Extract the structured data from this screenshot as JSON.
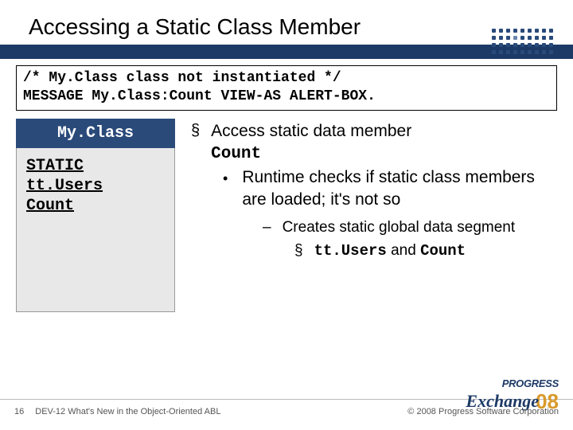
{
  "title": "Accessing a Static Class Member",
  "code": {
    "line1": "/* My.Class class not instantiated */",
    "line2": "MESSAGE My.Class:Count VIEW-AS ALERT-BOX."
  },
  "classBox": {
    "header": "My.Class",
    "line1": "STATIC",
    "line2": "tt.Users",
    "line3": "Count"
  },
  "bullets": {
    "main": "Access static data member",
    "mainCode": "Count",
    "sub": "Runtime checks if static class members are loaded; it's not so",
    "subsub": "Creates static global data segment",
    "subsubItemPrefix": "tt.Users",
    "subsubItemMid": " and ",
    "subsubItemSuffix": "Count"
  },
  "footer": {
    "slideNum": "16",
    "deck": "DEV-12 What's New in the Object-Oriented ABL",
    "copyright": "© 2008 Progress Software Corporation"
  },
  "logo": {
    "progress": "PROGRESS",
    "exchange": "Exchange",
    "year": "08"
  }
}
